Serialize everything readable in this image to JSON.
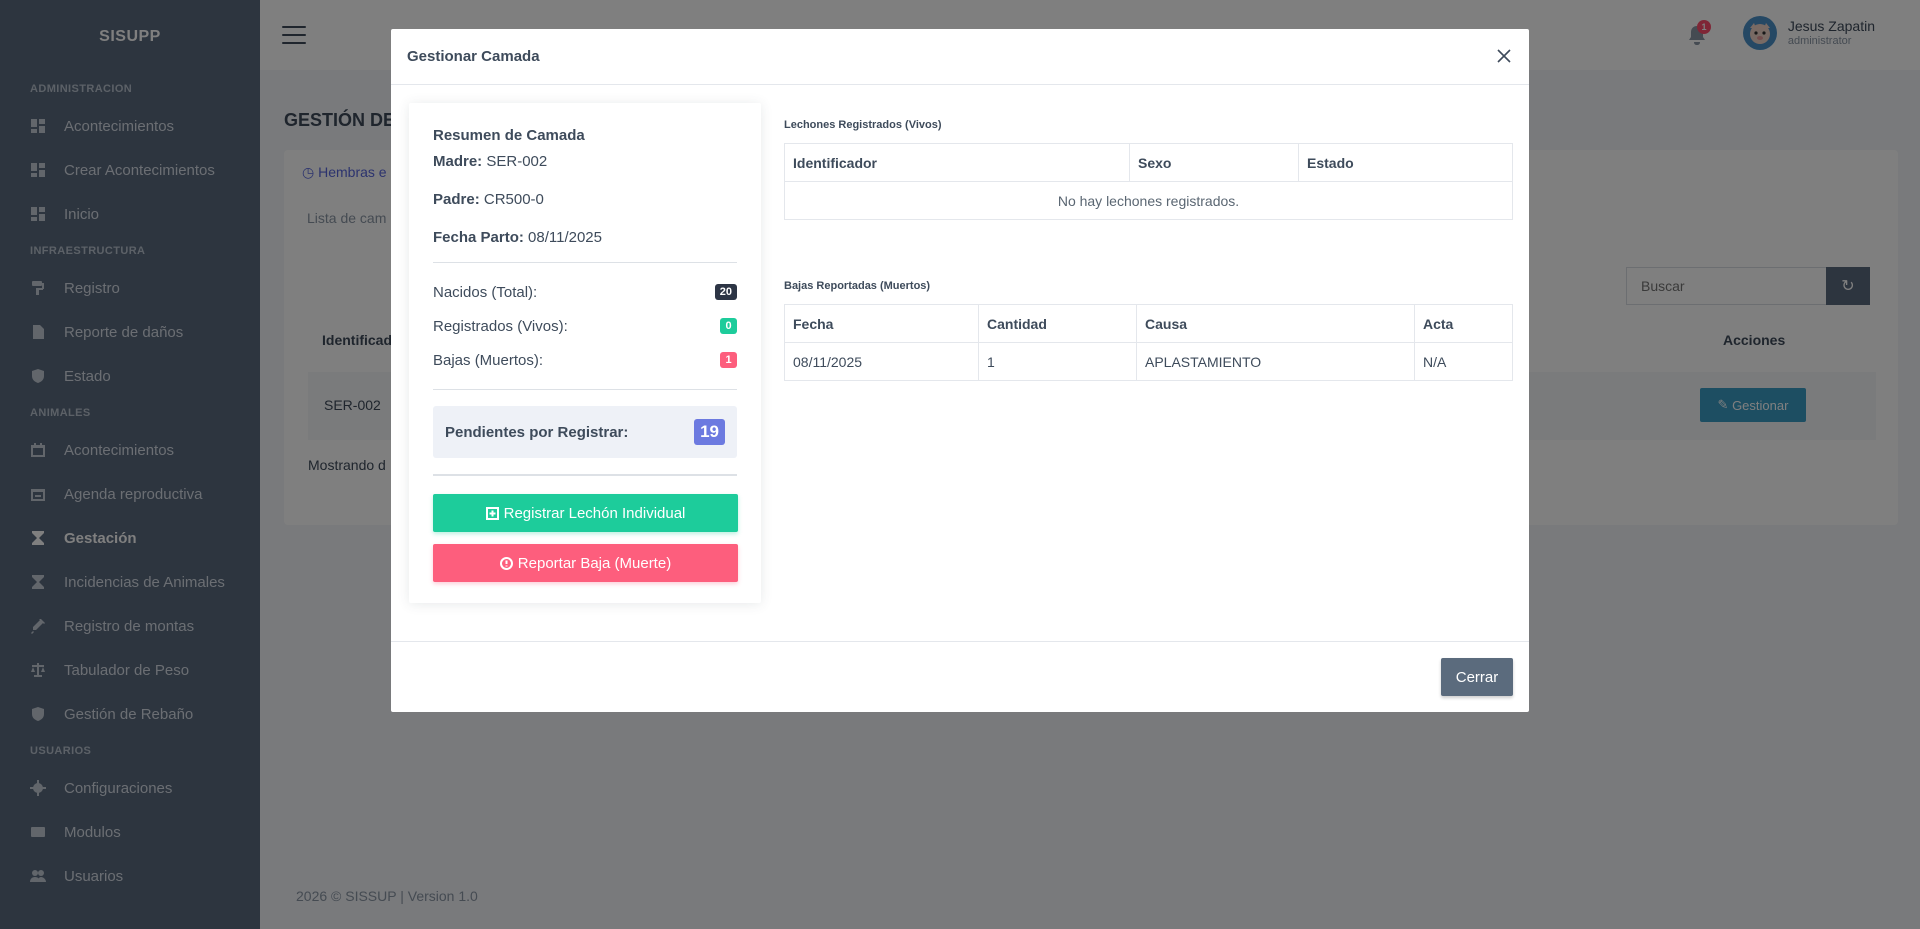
{
  "sidebar": {
    "brand": "SISUPP",
    "sections": [
      {
        "title": "ADMINISTRACION",
        "items": [
          {
            "label": "Acontecimientos",
            "icon": "dashboard-icon"
          },
          {
            "label": "Crear Acontecimientos",
            "icon": "dashboard-icon"
          },
          {
            "label": "Inicio",
            "icon": "dashboard-icon"
          }
        ]
      },
      {
        "title": "INFRAESTRUCTURA",
        "items": [
          {
            "label": "Registro",
            "icon": "paint-roller-icon"
          },
          {
            "label": "Reporte de daños",
            "icon": "file-icon"
          },
          {
            "label": "Estado",
            "icon": "shield-check-icon"
          }
        ]
      },
      {
        "title": "ANIMALES",
        "items": [
          {
            "label": "Acontecimientos",
            "icon": "calendar-icon"
          },
          {
            "label": "Agenda reproductiva",
            "icon": "calendar-minus-icon"
          },
          {
            "label": "Gestación",
            "icon": "hourglass-icon",
            "active": true
          },
          {
            "label": "Incidencias de Animales",
            "icon": "hourglass-icon"
          },
          {
            "label": "Registro de montas",
            "icon": "syringe-icon"
          },
          {
            "label": "Tabulador de Peso",
            "icon": "scale-icon"
          },
          {
            "label": "Gestión de Rebaño",
            "icon": "shield-icon"
          }
        ]
      },
      {
        "title": "USUARIOS",
        "items": [
          {
            "label": "Configuraciones",
            "icon": "gear-icon"
          },
          {
            "label": "Modulos",
            "icon": "card-icon"
          },
          {
            "label": "Usuarios",
            "icon": "users-icon"
          }
        ]
      }
    ]
  },
  "topbar": {
    "notification_count": "1",
    "user_name": "Jesus Zapatin",
    "user_role": "administrator"
  },
  "page": {
    "title": "GESTIÓN DE",
    "tab_label": "Hembras e",
    "card_subtitle": "Lista de cam",
    "search_placeholder": "Buscar",
    "col_identificador": "Identificad",
    "col_acciones": "Acciones",
    "row_identificador": "SER-002",
    "gestionar_label": "Gestionar",
    "showing_text": "Mostrando d",
    "footer": "2026 © SISSUP | Version 1.0"
  },
  "modal": {
    "title": "Gestionar Camada",
    "summary": {
      "title": "Resumen de Camada",
      "madre_label": "Madre:",
      "madre_value": "SER-002",
      "padre_label": "Padre:",
      "padre_value": "CR500-0",
      "fecha_label": "Fecha Parto:",
      "fecha_value": "08/11/2025",
      "nacidos_label": "Nacidos (Total):",
      "nacidos_value": "20",
      "registrados_label": "Registrados (Vivos):",
      "registrados_value": "0",
      "bajas_label": "Bajas (Muertos):",
      "bajas_value": "1",
      "pendientes_label": "Pendientes por Registrar:",
      "pendientes_value": "19",
      "btn_registrar": "Registrar Lechón Individual",
      "btn_reportar": "Reportar Baja (Muerte)"
    },
    "lechones": {
      "label": "Lechones Registrados (Vivos)",
      "headers": [
        "Identificador",
        "Sexo",
        "Estado"
      ],
      "empty": "No hay lechones registrados."
    },
    "bajas": {
      "label": "Bajas Reportadas (Muertos)",
      "headers": [
        "Fecha",
        "Cantidad",
        "Causa",
        "Acta"
      ],
      "rows": [
        [
          "08/11/2025",
          "1",
          "APLASTAMIENTO",
          "N/A"
        ]
      ]
    },
    "close_label": "Cerrar"
  },
  "colors": {
    "sidebar": "#5a6a7e",
    "primary": "#5867dd",
    "success": "#1dcc9b",
    "danger": "#fd5e7d",
    "info": "#3a9dc5",
    "dark_badge": "#2d3545"
  }
}
